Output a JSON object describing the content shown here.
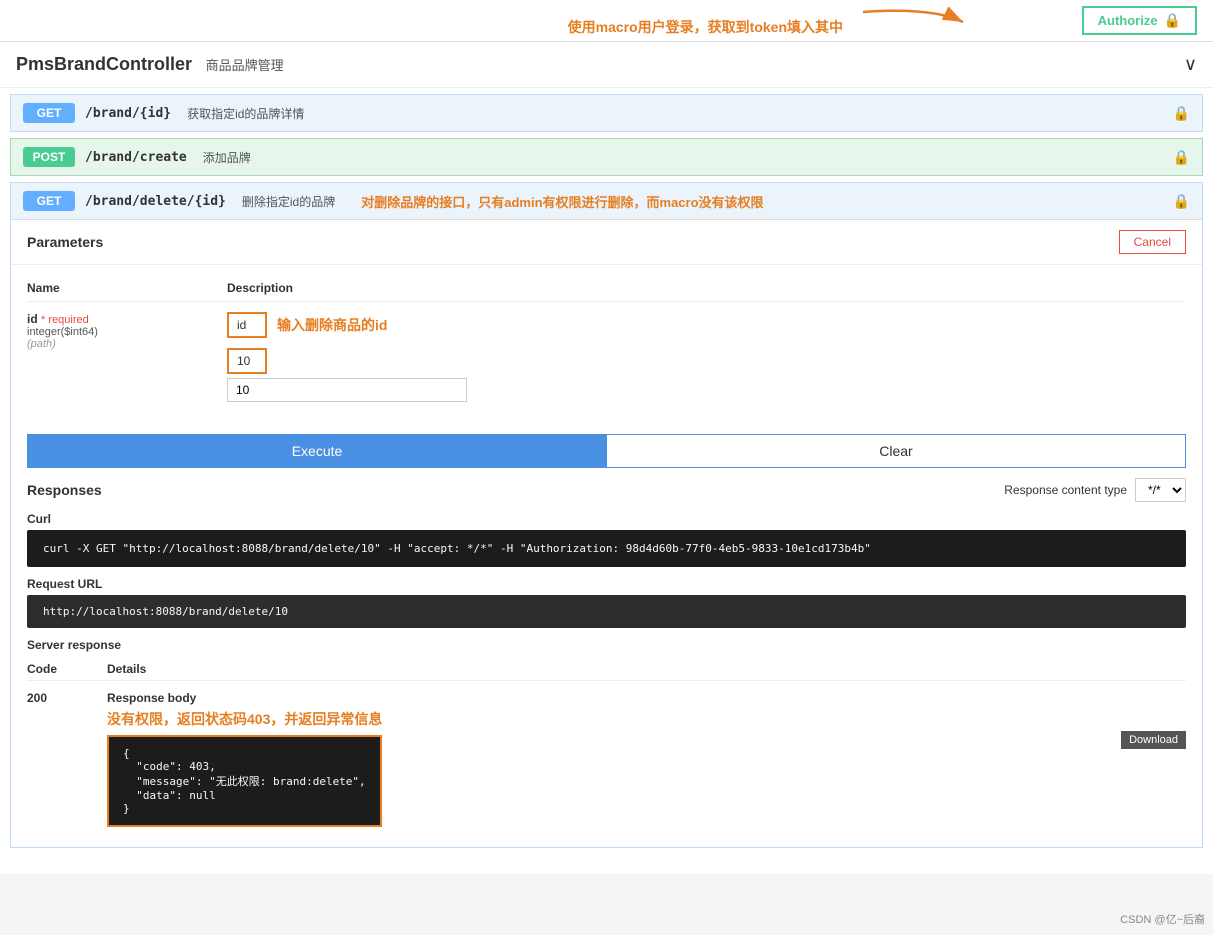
{
  "topbar": {
    "authorize_label": "Authorize",
    "annotation": "使用macro用户登录，获取到token填入其中"
  },
  "controller": {
    "name": "PmsBrandController",
    "subtitle": "商品品牌管理",
    "chevron": "∨"
  },
  "apis": [
    {
      "method": "GET",
      "path": "/brand/{id}",
      "desc": "获取指定id的品牌详情",
      "expanded": false
    },
    {
      "method": "POST",
      "path": "/brand/create",
      "desc": "添加品牌",
      "expanded": false
    },
    {
      "method": "GET",
      "path": "/brand/delete/{id}",
      "desc": "删除指定id的品牌",
      "expanded": true,
      "annotation": "对删除品牌的接口，只有admin有权限进行删除，而macro没有该权限"
    }
  ],
  "params": {
    "title": "Parameters",
    "cancel_label": "Cancel",
    "name_col": "Name",
    "desc_col": "Description",
    "id_label": "id",
    "id_required": "* required",
    "id_type": "integer($int64)",
    "id_path": "(path)",
    "id_field_label": "id",
    "id_annotation": "输入删除商品的id",
    "id_value": "10"
  },
  "actions": {
    "execute_label": "Execute",
    "clear_label": "Clear"
  },
  "responses": {
    "title": "Responses",
    "content_type_label": "Response content type",
    "content_type_value": "*/*",
    "curl_title": "Curl",
    "curl_value": "curl -X GET \"http://localhost:8088/brand/delete/10\" -H \"accept: */*\" -H \"Authorization: 98d4d60b-77f0-4eb5-9833-10e1cd173b4b\"",
    "request_url_title": "Request URL",
    "request_url_value": "http://localhost:8088/brand/delete/10",
    "server_response_title": "Server response",
    "code_col": "Code",
    "details_col": "Details",
    "response_code": "200",
    "response_body_label": "Response body",
    "response_annotation": "没有权限，返回状态码403，并返回异常信息",
    "response_body_value": "{\n  \"code\": 403,\n  \"message\": \"无此权限: brand:delete\",\n  \"data\": null\n}",
    "download_label": "Download"
  },
  "watermark": "CSDN @亿~后裔"
}
